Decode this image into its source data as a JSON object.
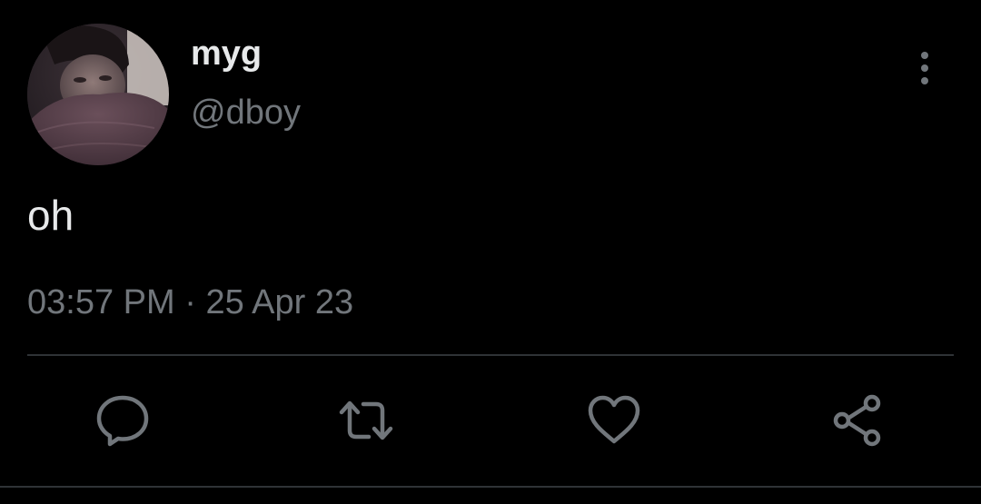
{
  "tweet": {
    "author": {
      "display_name": "myg",
      "handle": "@dboy",
      "avatar": "profile-photo"
    },
    "text": "oh",
    "time": "03:57 PM",
    "separator": "·",
    "date": "25 Apr 23"
  },
  "actions": {
    "reply_icon": "comment-bubble-icon",
    "retweet_icon": "retweet-arrows-icon",
    "like_icon": "heart-outline-icon",
    "share_icon": "share-nodes-icon",
    "more_icon": "vertical-dots-icon"
  },
  "colors": {
    "background": "#000000",
    "primary_text": "#e7e9ea",
    "secondary_text": "#71767b",
    "divider": "#2f3336"
  }
}
